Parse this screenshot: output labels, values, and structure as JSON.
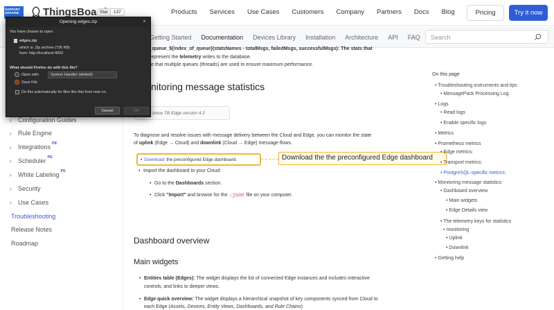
{
  "topnav": {
    "support_badge": [
      "SUPPORT",
      "UKRAINE"
    ],
    "logo_text": "ThingsBoard",
    "star_label": "Star",
    "star_count": "137",
    "links": [
      "Products",
      "Services",
      "Use Cases",
      "Customers",
      "Company",
      "Partners",
      "Docs",
      "Blog"
    ],
    "pricing_label": "Pricing",
    "try_label": "Try it now"
  },
  "subnav": {
    "links": [
      "Getting Started",
      "Documentation",
      "Devices Library",
      "Installation",
      "Architecture",
      "API",
      "FAQ"
    ],
    "active": "Documentation",
    "search_placeholder": "Search"
  },
  "sidebar": {
    "items": [
      {
        "label": "Configuration Guides",
        "chevron": true,
        "pe": ""
      },
      {
        "label": "Rule Engine",
        "chevron": true,
        "pe": ""
      },
      {
        "label": "Integrations",
        "chevron": true,
        "pe": "PE"
      },
      {
        "label": "Scheduler",
        "chevron": true,
        "pe": "PE"
      },
      {
        "label": "White Labeling",
        "chevron": true,
        "pe": "PE"
      },
      {
        "label": "Security",
        "chevron": true,
        "pe": ""
      },
      {
        "label": "Use Cases",
        "chevron": true,
        "pe": ""
      }
    ],
    "plain": [
      "Troubleshooting",
      "Release Notes",
      "Roadmap"
    ],
    "active": "Troubleshooting"
  },
  "content": {
    "line1": "_queue_${index_of_queue}(statsNames - totalMsgs, failedMsgs, successfulMsgs): The stats that",
    "line2_pre": "represent the ",
    "line2_b": "telemetry",
    "line2_post": " writes to the database.",
    "line3": "te that multiple queues (threads) are used to ensure maximum performance.",
    "heading": "nitoring message statistics",
    "note": "ilable since TB Edge version 4.2",
    "intro1": "To diagnose and resolve issues with message delivery between the Cloud and Edge, you can monitor the state",
    "intro2_pre": "of ",
    "intro2_b1": "uplink",
    "intro2_mid": " (Edge → Cloud) and ",
    "intro2_b2": "downlink",
    "intro2_post": " (Cloud → Edge) message flows.",
    "hl_link": "Download",
    "hl_text": "the preconfigured Edge dashboard.",
    "callout": "Download the the preconfigured Edge dashboard",
    "import": "Import the dashboard to your Cloud:",
    "go_pre": "Go to the ",
    "go_b": "Dashboards",
    "go_post": " section.",
    "click_pre": "Click ",
    "click_b": "\"Import\"",
    "click_mid": " and browse for the ",
    "click_code": ".json",
    "click_post": " file on your computer.",
    "h_dashboard": "Dashboard overview",
    "h_widgets": "Main widgets",
    "entities_b": "Entities table (Edges):",
    "entities_t1": " The widget displays the list of connected Edge instances and includes interactive",
    "entities_t2": "controls, and links to deeper views.",
    "quick_b": "Edge quick overview:",
    "quick_t1": " The widget displays a hierarchical snapshot of key components synced from Cloud to",
    "quick_t2_pre": "each Edge (",
    "quick_t2_i": "Assets, Devices, Entity Views, Dashboards, and Rule Chains",
    "quick_t2_post": ")"
  },
  "toc": {
    "title": "On this page",
    "items": [
      "Troubleshooting instruments and tips",
      "MessagePack Processing Log",
      "Logs",
      "Read logs",
      "Enable specific logs",
      "Metrics",
      "Prometheus metrics",
      "Edge metrics:",
      "Transport metrics:",
      "PostgreSQL-specific metrics:",
      "Monitoring message statistics",
      "Dashboard overview",
      "Main widgets",
      "Edge Details view",
      "The telemetry keys for statistics",
      "monitoring",
      "Uplink",
      "Downlink",
      "Getting help"
    ]
  },
  "dialog": {
    "title": "Opening edges.zip",
    "close": "×",
    "chosen": "You have chosen to open:",
    "filename": "edges.zip",
    "which": "which is: Zip archive (736 KB)",
    "from": "from: http://localhost:4000",
    "question": "What should Firefox do with this file?",
    "open_with": "Open with",
    "select": "System Handler (default)",
    "save_file": "Save File",
    "auto": "Do this automatically for files like this from now on.",
    "cancel": "Cancel",
    "ok": "OK"
  }
}
